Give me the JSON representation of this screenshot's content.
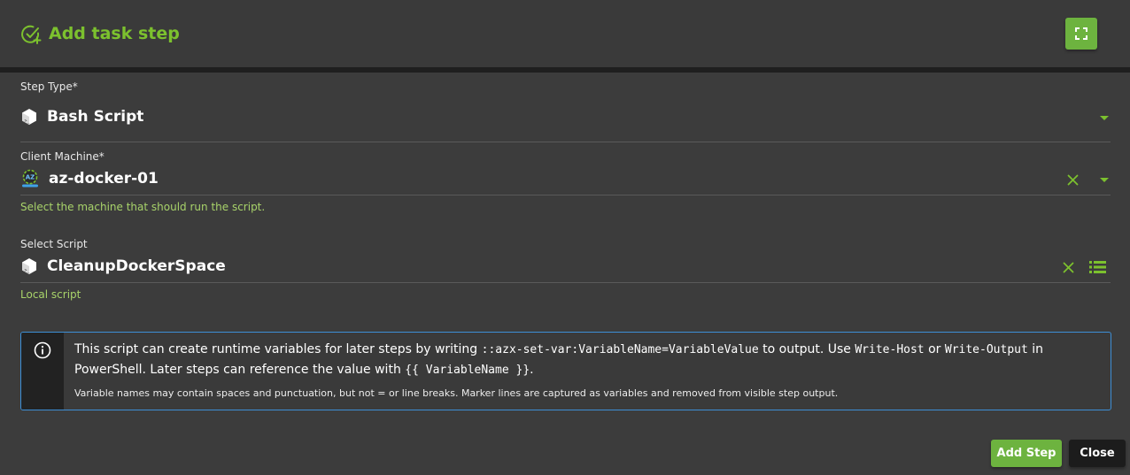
{
  "dialog": {
    "title": "Add task step"
  },
  "step_type": {
    "label": "Step Type*",
    "value": "Bash Script"
  },
  "client_machine": {
    "label": "Client Machine*",
    "value": "az-docker-01",
    "hint": "Select the machine that should run the script."
  },
  "select_script": {
    "label": "Select Script",
    "value": "CleanupDockerSpace",
    "hint": "Local script"
  },
  "info": {
    "t1": "This script can create runtime variables for later steps by writing ",
    "c1": "::azx-set-var:VariableName=VariableValue",
    "t2": " to output. Use ",
    "c2": "Write-Host",
    "t3": " or ",
    "c3": "Write-Output",
    "t4": " in PowerShell. Later steps can reference the value with ",
    "c4": "{{ VariableName }}",
    "t5": ".",
    "sub": "Variable names may contain spaces and punctuation, but not = or line breaks. Marker lines are captured as variables and removed from visible step output."
  },
  "footer": {
    "add_label": "Add Step",
    "close_label": "Close"
  },
  "colors": {
    "accent": "#7cc12e",
    "button_green": "#6db33f",
    "info_border": "#3d8fd6"
  }
}
